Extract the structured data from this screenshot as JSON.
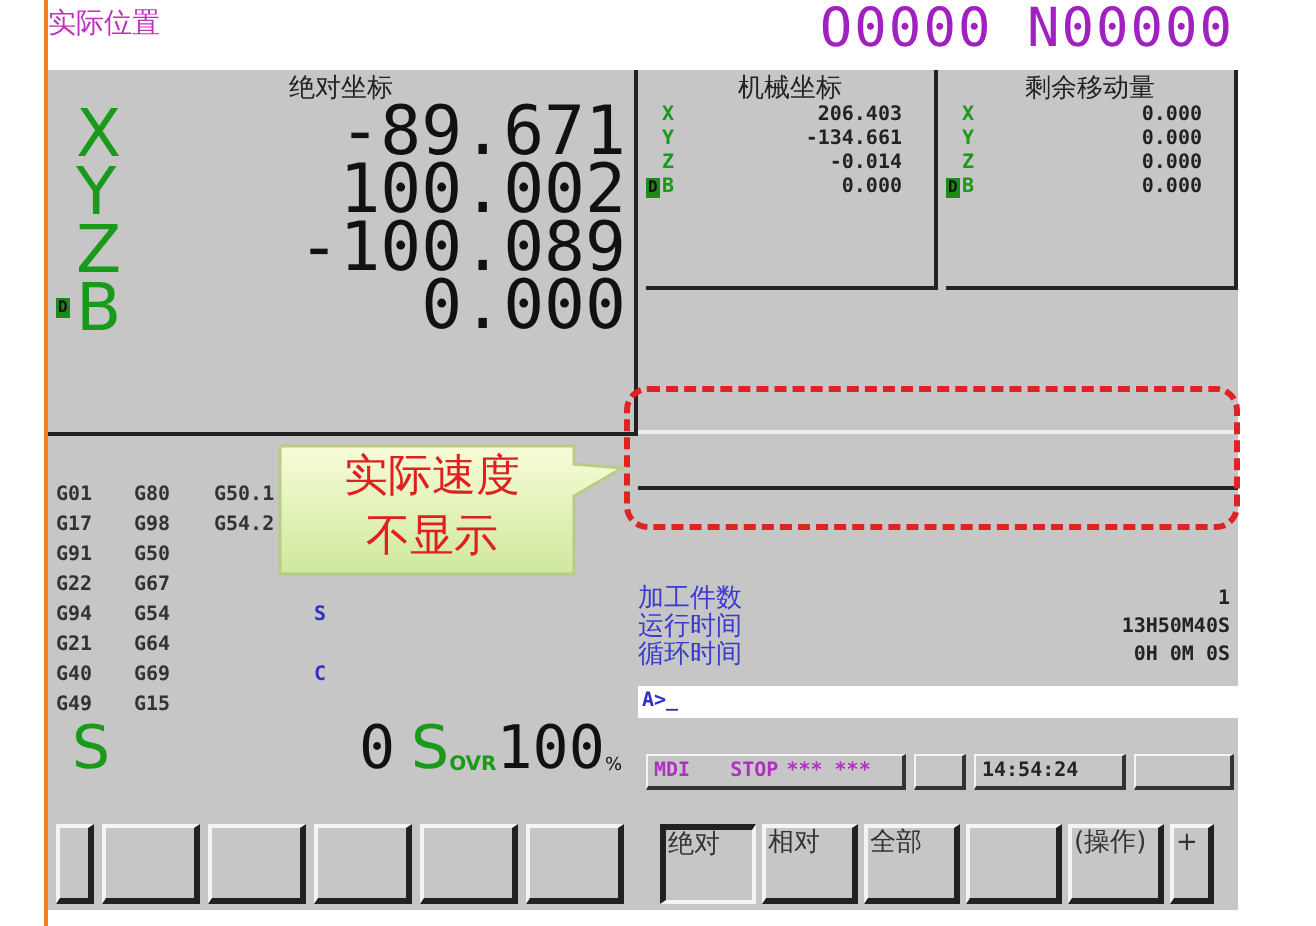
{
  "header": {
    "title": "实际位置",
    "program_number": "O0000 N00000"
  },
  "absolute": {
    "heading": "绝对坐标",
    "axes": [
      {
        "axis": "X",
        "value": "-89.671"
      },
      {
        "axis": "Y",
        "value": "100.002"
      },
      {
        "axis": "Z",
        "value": "-100.089"
      },
      {
        "axis": "B",
        "value": "0.000",
        "marker": "D"
      }
    ]
  },
  "machine": {
    "heading": "机械坐标",
    "axes": [
      {
        "axis": "X",
        "value": "206.403"
      },
      {
        "axis": "Y",
        "value": "-134.661"
      },
      {
        "axis": "Z",
        "value": "-0.014"
      },
      {
        "axis": "B",
        "value": "0.000",
        "marker": "D"
      }
    ]
  },
  "remaining": {
    "heading": "剩余移动量",
    "axes": [
      {
        "axis": "X",
        "value": "0.000"
      },
      {
        "axis": "Y",
        "value": "0.000"
      },
      {
        "axis": "Z",
        "value": "0.000"
      },
      {
        "axis": "B",
        "value": "0.000",
        "marker": "D"
      }
    ]
  },
  "modal_codes": [
    [
      "G01",
      "G80",
      "G50.1"
    ],
    [
      "G17",
      "G98",
      "G54.2"
    ],
    [
      "G91",
      "G50"
    ],
    [
      "G22",
      "G67"
    ],
    [
      "G94",
      "G54"
    ],
    [
      "G21",
      "G64"
    ],
    [
      "G40",
      "G69"
    ],
    [
      "G49",
      "G15"
    ]
  ],
  "modal_labels": [
    "S",
    "C"
  ],
  "spindle": {
    "label": "S",
    "value": "0",
    "override_label": "S",
    "override_sub": "OVR",
    "override_value": "100",
    "unit": "%"
  },
  "counters": [
    {
      "label": "加工件数",
      "value": "1"
    },
    {
      "label": "运行时间",
      "value": "13H50M40S"
    },
    {
      "label": "循环时间",
      "value": "0H 0M 0S"
    }
  ],
  "input_line": {
    "value": "A>_"
  },
  "status_bar": {
    "mode": "MDI",
    "state": "STOP",
    "alarm": "*** ***",
    "time": "14:54:24"
  },
  "soft_keys_left": [
    {
      "kind": "narrow"
    },
    {
      "kind": "blank"
    },
    {
      "kind": "blank"
    },
    {
      "kind": "blank"
    },
    {
      "kind": "blank"
    },
    {
      "kind": "blank"
    }
  ],
  "soft_keys_right": [
    {
      "label": "绝对",
      "selected": true
    },
    {
      "label": "相对",
      "selected": false
    },
    {
      "label": "全部",
      "selected": false
    },
    {
      "selected": false
    },
    {
      "label": "(操作)",
      "selected": false
    },
    {
      "label": "+",
      "selected": false
    }
  ],
  "annotation": {
    "lines": [
      "实际速度",
      "不显示"
    ]
  }
}
